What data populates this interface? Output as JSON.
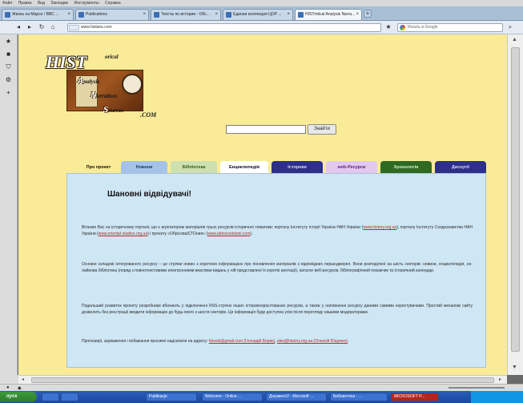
{
  "menubar": {
    "items": [
      "Файл",
      "Правка",
      "Вид",
      "Закладки",
      "Инструменты",
      "Справка"
    ]
  },
  "browser_tabs": [
    {
      "label": "Жизнь на Марсе / BBC ..."
    },
    {
      "label": "Publications"
    },
    {
      "label": "Тексты по истории - Обс..."
    },
    {
      "label": "Единая коллекция ЦОР ..."
    },
    {
      "label": "HISTmtical Analysis Narra..."
    }
  ],
  "address_bar": {
    "url": "www.histans.com",
    "site_label": "hist"
  },
  "browser_search": {
    "placeholder": "Искать в Google"
  },
  "logo": {
    "main": "HIST",
    "letters": [
      "A",
      "N",
      "S"
    ],
    "words": [
      "orical",
      "nalysis",
      "arratives",
      "ources"
    ],
    "suffix": ".COM"
  },
  "site_search": {
    "button": "Знайти"
  },
  "nav_tabs": [
    {
      "label": "Про проект",
      "bg": "#faeb98",
      "fg": "#111111"
    },
    {
      "label": "Новини",
      "bg": "#a5c3e8",
      "fg": "#1a3f7a"
    },
    {
      "label": "Бібліотека",
      "bg": "#cde0b0",
      "fg": "#2f5a20"
    },
    {
      "label": "Енциклопедія",
      "bg": "#ffffff",
      "fg": "#111111"
    },
    {
      "label": "Історики",
      "bg": "#2e2f86",
      "fg": "#d7d9ff"
    },
    {
      "label": "web-Ресурси",
      "bg": "#e2c8ef",
      "fg": "#5c1e7a"
    },
    {
      "label": "Хронологія",
      "bg": "#2f6a22",
      "fg": "#d3f0c8"
    },
    {
      "label": "Дискусії",
      "bg": "#2e2f86",
      "fg": "#d7d9ff"
    }
  ],
  "panel": {
    "heading": "Шановні відвідувачі!",
    "p1_a": "Вітаємо Вас на історичному порталі, що є агрегатором матеріалів трьох ресурсів історичної тематики: порталу Інституту історії України НАН України (",
    "p1_link1": "www.history.org.ua",
    "p1_b": "), порталу Інституту Сходознавства НАН України (",
    "p1_link2": "www.oriental-studies.org.ua",
    "p1_c": ") і проекту «ОбрісоваІСТОния» (",
    "p1_link3": "www.obrisoveistorii.com",
    "p1_d": ").",
    "p2": "Основні складові інтегрованого ресурсу – це стрічки новин з короткою інформацією про поновлення матеріалів з відповідних першоджерел. Вони розподілені на шість секторів: новини, енциклопедія, он-лайнова бібліотека (поряд з повнотекстовими електронними версіями видань у ній представлені їх короткі анотації), каталог веб-ресурсів, бібліографічний покажчик та історичний календар.",
    "p3": "Подальший розвиток проекту розробники вбачають у підключенні RSS-стрічок інших історикоорієнтованих ресурсів, а також у наповненні ресурсу даними самими користувачами. Простий механізм сайту дозволить без реєстрації вводити інформацію до будь-якого з шести секторів. Ця інформація буде доступна усім після перегляду нашими модераторами.",
    "p4_a": "Пропозиції, зауваження і побажання просимо надсилати на адресу: ",
    "p4_link1": "hbosik@gmail.com (Геннадій Боряк)",
    "p4_b": ", ",
    "p4_link2": "alex@history.org.ua (Олексій Ющенко)",
    "p4_c": "."
  },
  "taskbar": {
    "start": "пуск",
    "items": [
      "",
      "",
      "Publikacje",
      "Welcome - Online ...",
      "Документ2 - Microsoft ...",
      "Библиотека - ...",
      "MICROSOFT P..."
    ],
    "tray_time": ""
  },
  "colors": {
    "page_bg": "#faeb98",
    "panel_bg": "#cfe6f4",
    "link": "#b02a2a"
  }
}
